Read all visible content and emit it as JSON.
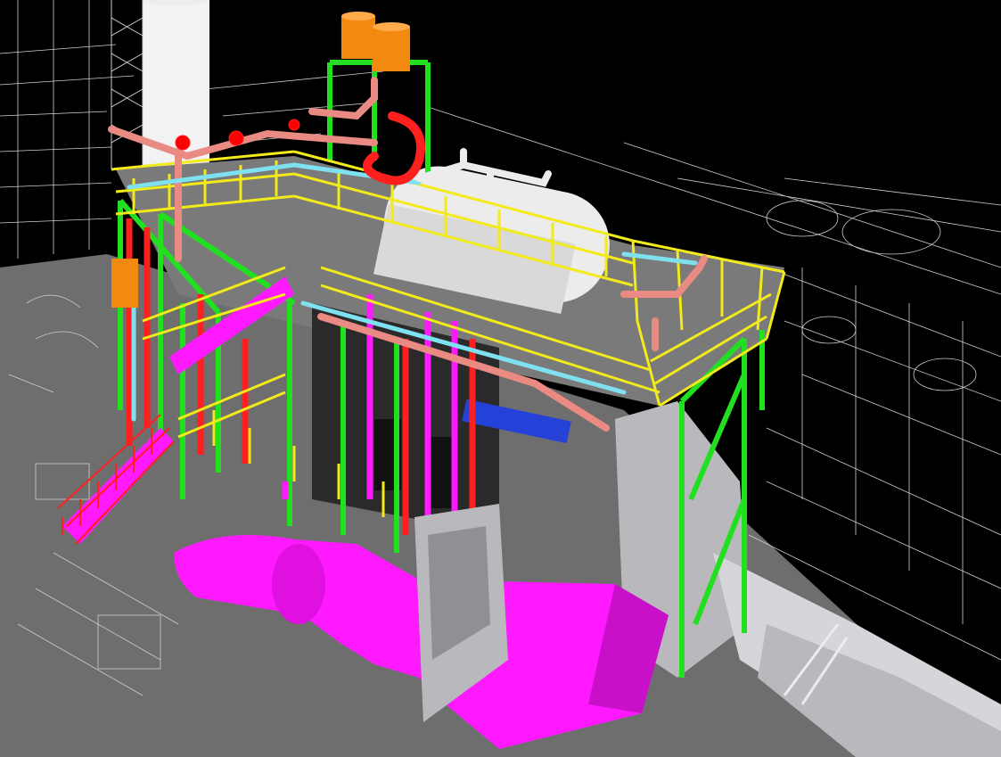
{
  "viewport": {
    "kind": "3d-plant-model-view",
    "background_color": "#000000"
  },
  "scene": {
    "floor_color": "#6e6e6e",
    "linework_color": "#cfcfcf",
    "palette": {
      "structure_green": "#22e01f",
      "column_red": "#ff1f1f",
      "handrail_yellow": "#f2ea1a",
      "duct_magenta": "#ff19ff",
      "drum_white": "#ececec",
      "cladding_grey": "#b9b9bd",
      "pipe_salmon": "#e98b83",
      "pipe_cyan": "#7fe0f0",
      "valve_red": "#ff0000",
      "vent_orange": "#f28a12",
      "stack_white": "#f2f2f2",
      "panel_dark": "#2a2a2a",
      "blue_beam": "#2442d8"
    }
  }
}
